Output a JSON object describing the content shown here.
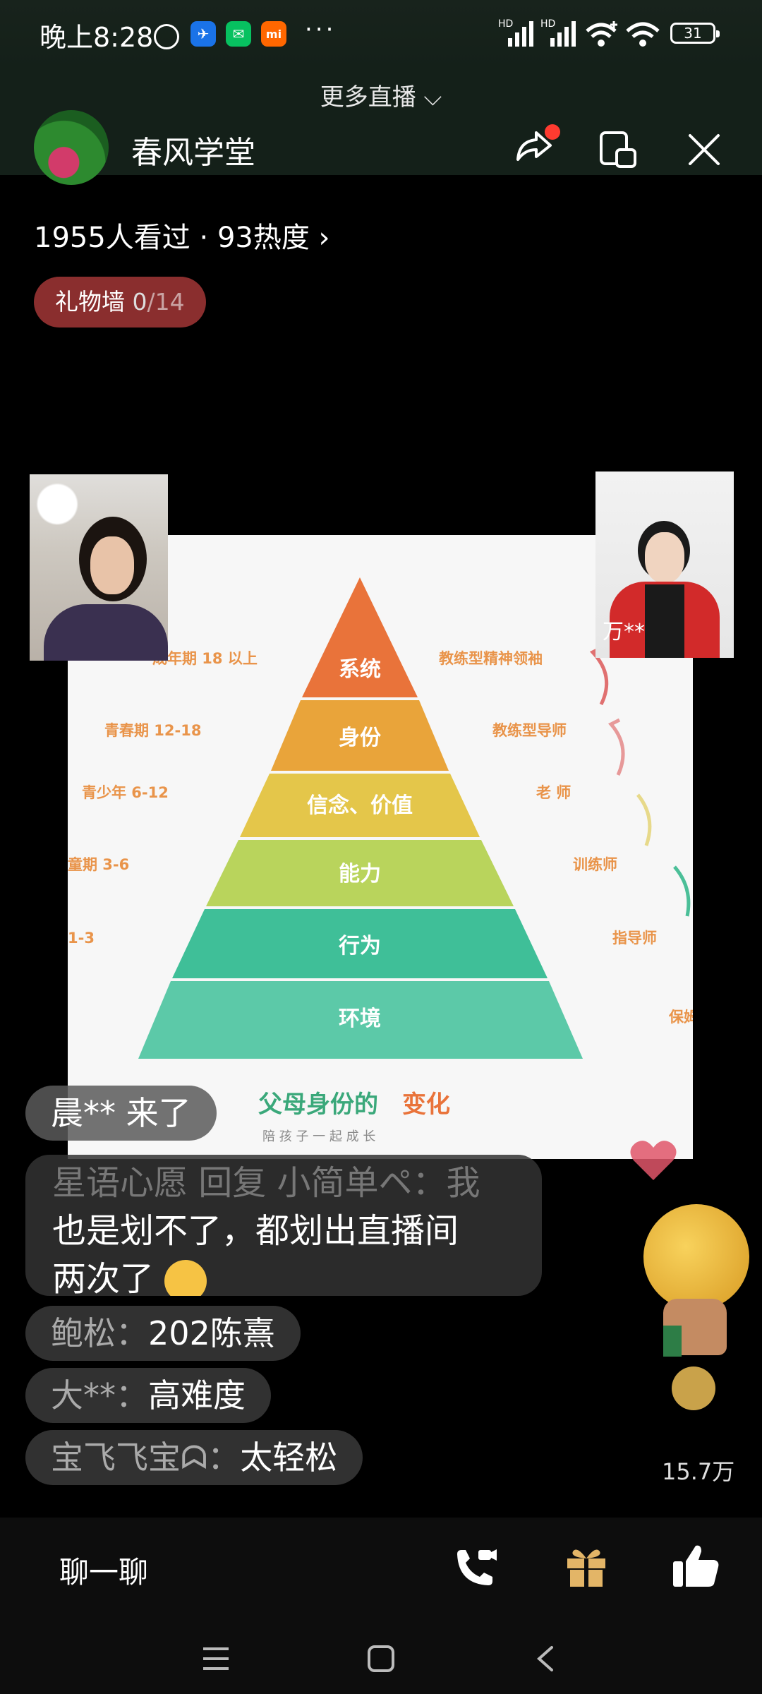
{
  "status_bar": {
    "time": "晚上8:28",
    "more_indicator": "···",
    "battery": "31",
    "signal_label": "HD"
  },
  "header": {
    "more_live": "更多直播 ⌵",
    "channel_name": "春风学堂"
  },
  "stats": {
    "viewers": "1955人看过 · 93热度 ›"
  },
  "gift_wall": {
    "label": "礼物墙 ",
    "count": "0",
    "total": "/14"
  },
  "slide": {
    "title_a": "父母身份的",
    "title_b": "变化",
    "subtitle": "陪 孩 子 一 起 成 长",
    "layers": [
      "系统",
      "身份",
      "信念、价值",
      "能力",
      "行为",
      "环境"
    ],
    "ages": [
      "成年期 18 以上",
      "青春期 12-18",
      "青少年 6-12",
      "童期 3-6",
      "1-3"
    ],
    "roles": [
      "教练型精神领袖",
      "教练型导师",
      "老 师",
      "训练师",
      "指导师",
      "保姆"
    ]
  },
  "cameras": {
    "right_name": "万**"
  },
  "chat": {
    "joined": "晨** 来了",
    "big_msg_faded": "星语心愿 回复 小简单ペ：我",
    "big_msg_line2": "也是划不了，都划出直播间",
    "big_msg_line3": "两次了",
    "messages": [
      {
        "user": "鲍松：",
        "text": "202陈熹"
      },
      {
        "user": "大**：",
        "text": "高难度"
      },
      {
        "user": "宝飞飞宝ᗣ：",
        "text": "太轻松"
      }
    ]
  },
  "likes_count": "15.7万",
  "bottom_bar": {
    "chat_placeholder": "聊一聊"
  },
  "colors": {
    "accent_red": "#ff3b30",
    "gift_wall_bg": "#8a2e2e",
    "pyramid": [
      "#e9733a",
      "#e9a43a",
      "#e4c64a",
      "#b9d45c",
      "#3fbf98",
      "#5cc9a8"
    ]
  }
}
